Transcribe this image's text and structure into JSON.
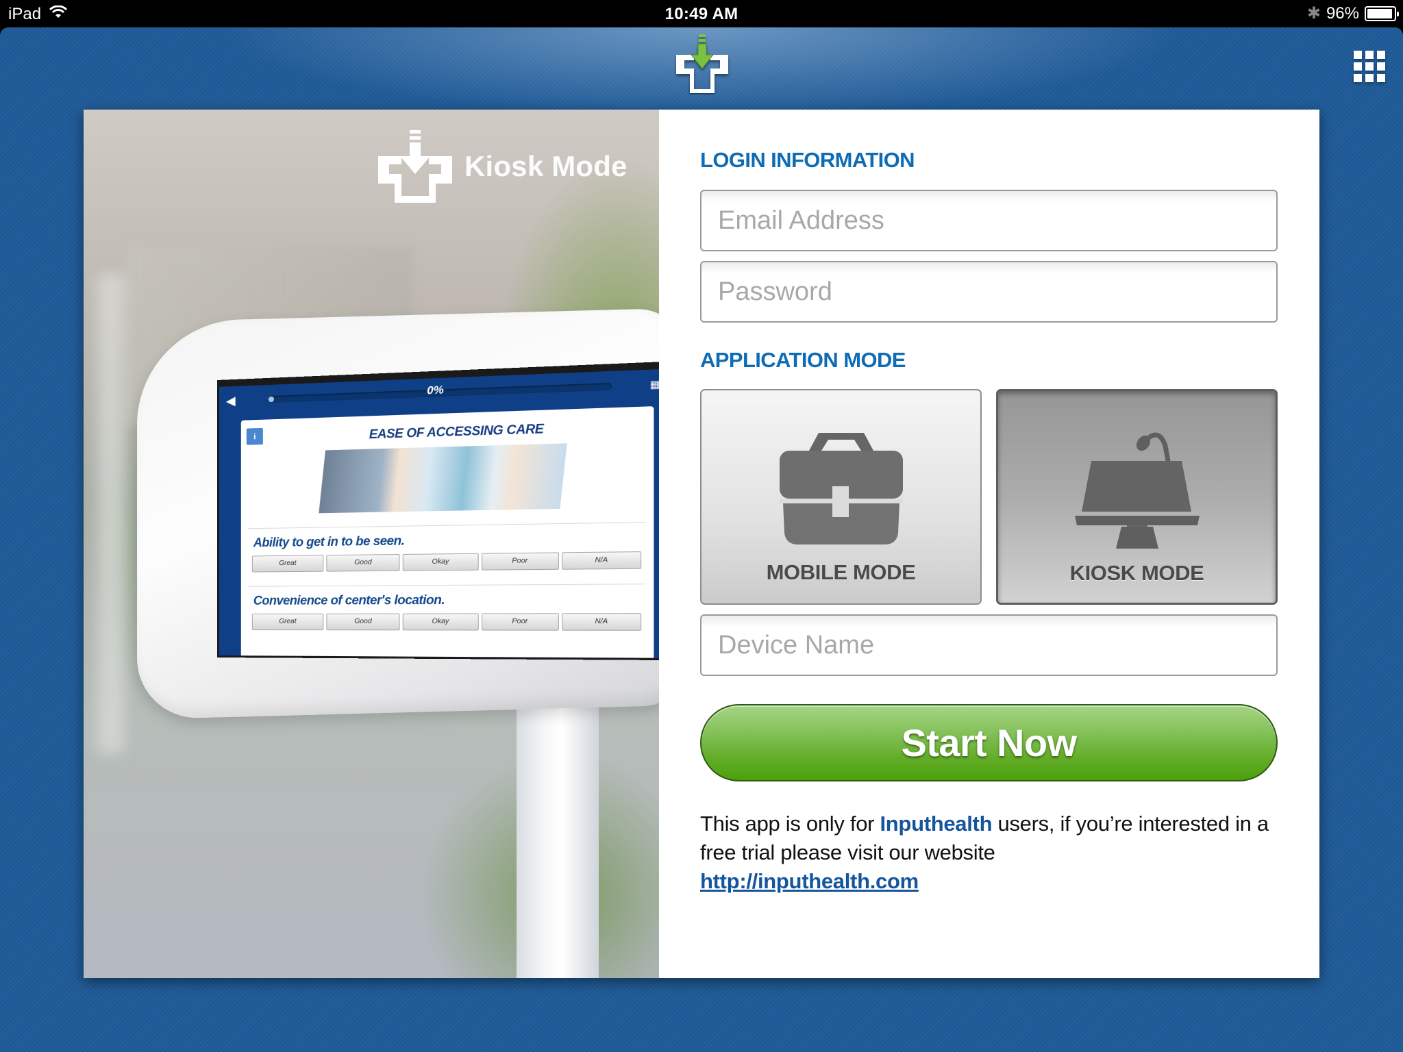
{
  "status_bar": {
    "device": "iPad",
    "time": "10:49 AM",
    "battery_percent_label": "96%",
    "battery_level": 0.96,
    "icons": [
      "wifi-icon",
      "bluetooth-icon",
      "battery-icon"
    ]
  },
  "header": {
    "logo_icon": "inputhealth-cross-arrow-logo",
    "menu_icon": "apps-grid-icon"
  },
  "hero": {
    "brand_label": "Kiosk Mode",
    "tablet": {
      "progress_label": "0%",
      "progress": 0,
      "survey_title": "EASE OF ACCESSING CARE",
      "info_label": "i",
      "questions": [
        {
          "text": "Ability to get in to be seen.",
          "options": [
            "Great",
            "Good",
            "Okay",
            "Poor",
            "N/A"
          ]
        },
        {
          "text": "Convenience of center's location.",
          "options": [
            "Great",
            "Good",
            "Okay",
            "Poor",
            "N/A"
          ]
        }
      ]
    }
  },
  "login": {
    "heading": "LOGIN INFORMATION",
    "email": {
      "value": "",
      "placeholder": "Email Address"
    },
    "password": {
      "value": "",
      "placeholder": "Password"
    }
  },
  "application_mode": {
    "heading": "APPLICATION MODE",
    "selected": "kiosk",
    "modes": [
      {
        "id": "mobile",
        "label": "MOBILE MODE",
        "icon": "briefcase-medical-icon",
        "selected": false
      },
      {
        "id": "kiosk",
        "label": "KIOSK MODE",
        "icon": "podium-kiosk-icon",
        "selected": true
      }
    ],
    "device_name": {
      "value": "",
      "placeholder": "Device Name"
    }
  },
  "actions": {
    "start_label": "Start Now"
  },
  "footer_info": {
    "text_before": "This app is only for ",
    "brand": "Inputhealth",
    "text_after": " users, if you’re interested in a free trial please visit our website",
    "link": "http://inputhealth.com"
  },
  "colors": {
    "background_blue": "#1e5b9a",
    "heading_blue": "#0e6cb4",
    "link_blue": "#14559c",
    "start_green": "#64ad2a",
    "logo_green": "#7cc242"
  }
}
